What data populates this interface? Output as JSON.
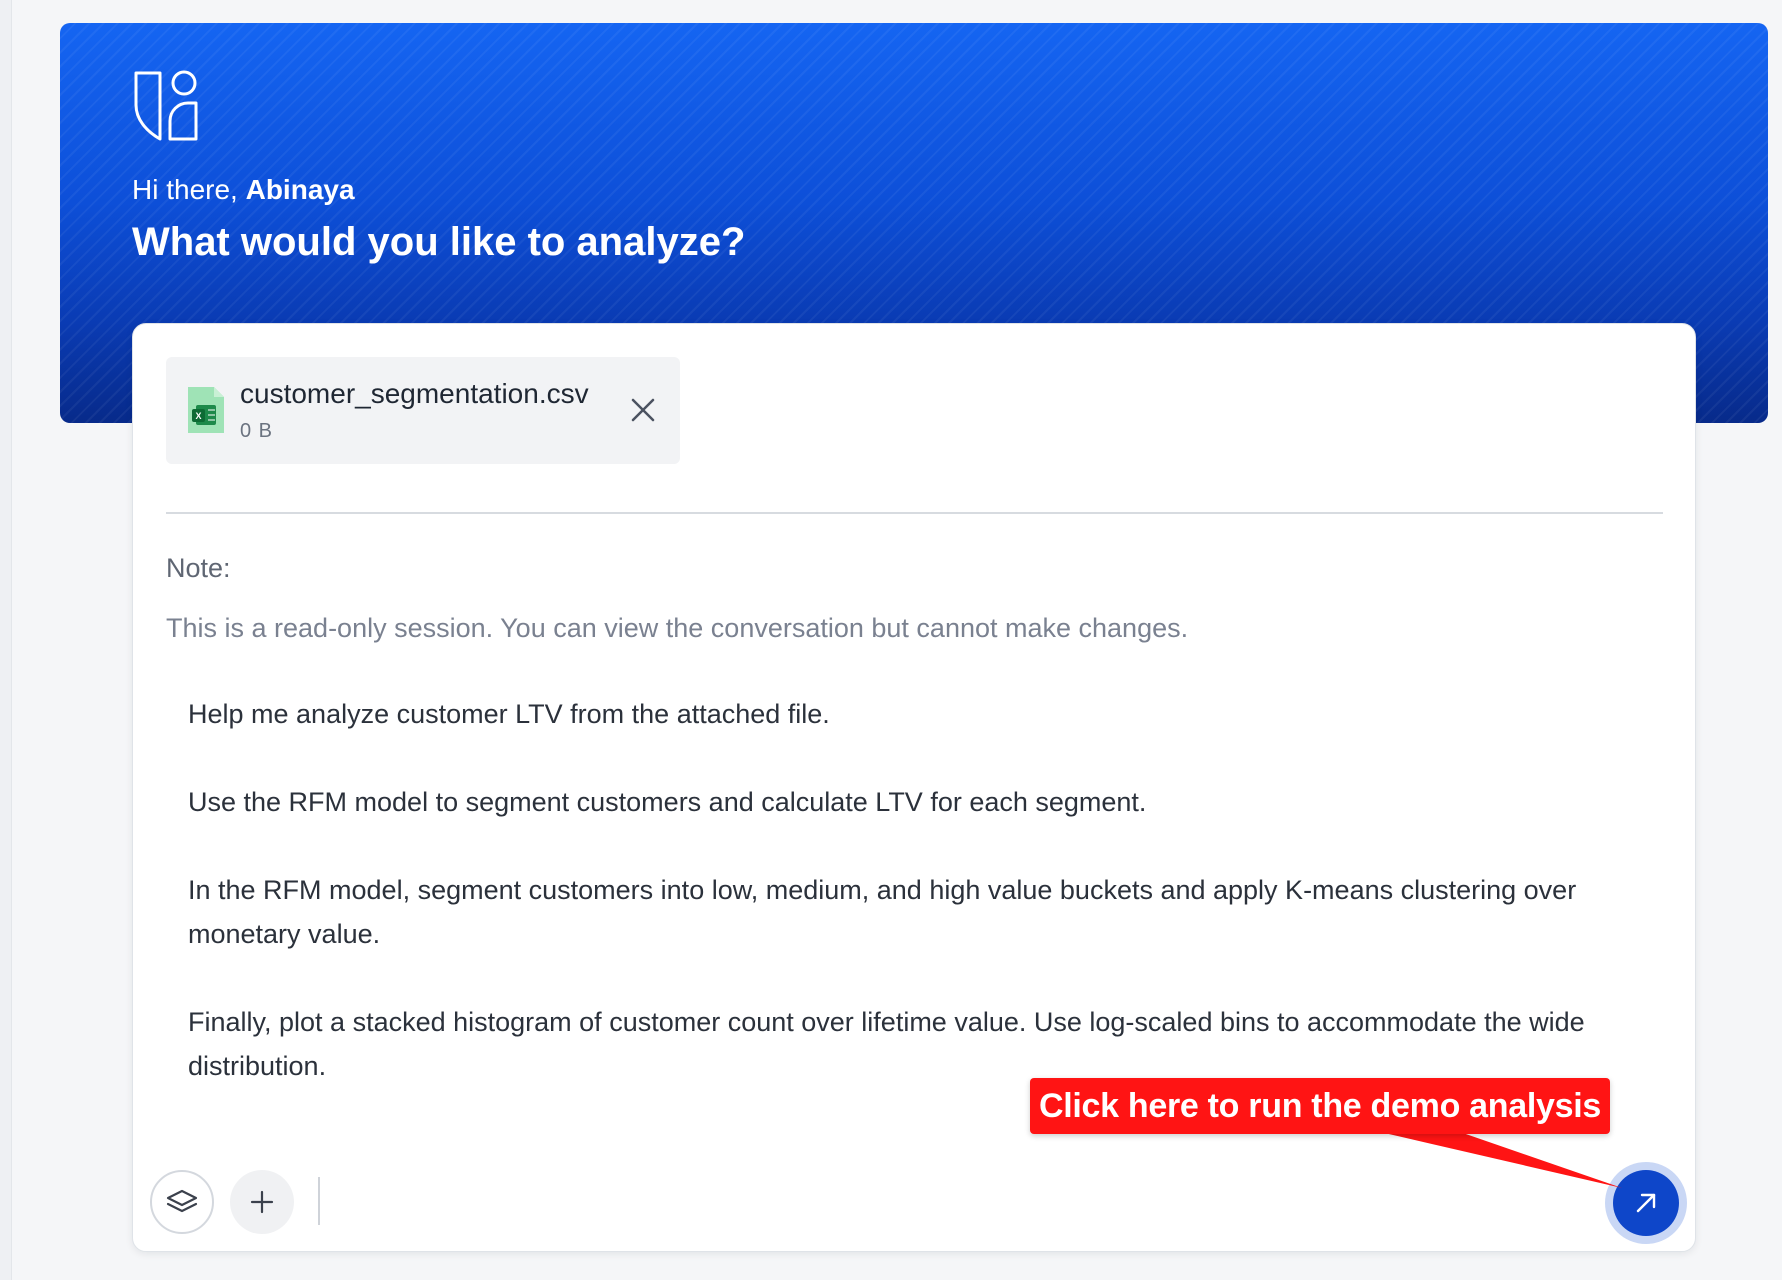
{
  "hero": {
    "greeting_prefix": "Hi there, ",
    "user_name": "Abinaya",
    "headline": "What would you like to analyze?"
  },
  "attachment": {
    "file_name": "customer_segmentation.csv",
    "file_size": "0 B",
    "icon": "excel-file-icon"
  },
  "note": {
    "title": "Note:",
    "text": "This is a read-only session. You can view the conversation but cannot make changes."
  },
  "prompt": {
    "paragraphs": [
      "Help me analyze customer LTV from the attached file.",
      "Use the RFM model to segment customers and calculate LTV for each segment.",
      "In the RFM model, segment customers into low, medium, and high value buckets and apply K-means clustering over monetary value.",
      "Finally, plot a stacked histogram of customer count over lifetime value.  Use log-scaled bins to accommodate the wide distribution."
    ]
  },
  "toolbar": {
    "layers_icon": "layers-icon",
    "add_icon": "plus-icon",
    "send_icon": "arrow-up-right-icon"
  },
  "callout": {
    "text": "Click here to run the demo analysis"
  },
  "colors": {
    "hero_top": "#1565f2",
    "hero_bottom": "#072a8a",
    "send_button": "#0e46c9",
    "callout": "#ff1414"
  }
}
